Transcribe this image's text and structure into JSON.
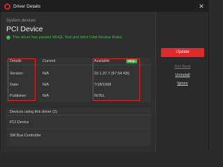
{
  "window": {
    "title": "Driver Details",
    "close_glyph": "✕"
  },
  "header": {
    "section_label": "System devices",
    "device_name": "PCI Device",
    "whql_text": "This driver has passed WHQL Test and strict IObit Review Rules."
  },
  "details": {
    "columns": {
      "details": "Details",
      "current": "Current",
      "available": "Available",
      "badge": "WHQL"
    },
    "rows": [
      {
        "label": "Version:",
        "current": "N/A",
        "available": "10.1.37.7 (97.54 KB)"
      },
      {
        "label": "Date:",
        "current": "N/A",
        "available": "7/18/1968"
      },
      {
        "label": "Publisher:",
        "current": "N/A",
        "available": "INTEL"
      }
    ]
  },
  "using": {
    "title": "Devices using this driver (2)",
    "items": [
      "PCI Device",
      "SM Bus Controller"
    ]
  },
  "side": {
    "update_label": "Update",
    "roll_back_label": "Roll Back",
    "uninstall_label": "Uninstall",
    "ignore_label": "Ignore"
  },
  "colors": {
    "accent": "#e1282a",
    "whql_green": "#3aa64b",
    "highlight": "#e02626",
    "background": "#2e2e2e"
  },
  "icons": {
    "app": "driver-booster-icon",
    "check": "check-circle-icon",
    "close": "close-icon"
  }
}
